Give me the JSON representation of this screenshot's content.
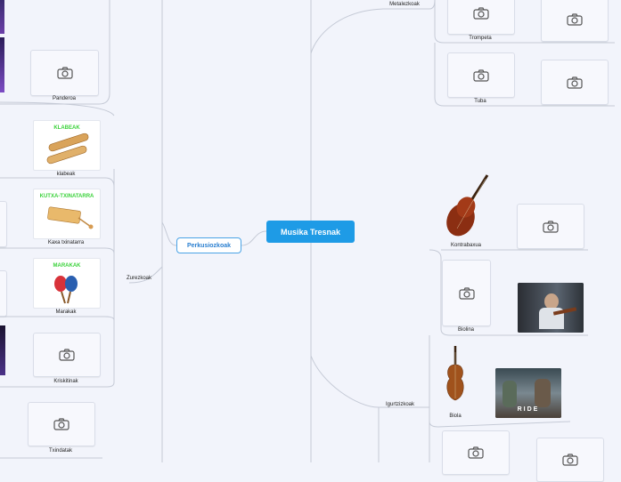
{
  "map": {
    "central": "Musika Tresnak",
    "branch": "Perkusiozkoak"
  },
  "labels": {
    "pandero": "Panderoa",
    "klabeak": "klabeak",
    "kaxa": "Kaxa txinatarra",
    "marakak": "Marakak",
    "krisk": "Kriskitinak",
    "txin": "Txindatak",
    "zurezkoak": "Zurezkoak",
    "metalezkoak": "Metalezkoak",
    "trompeta": "Trompeta",
    "tuba": "Tuba",
    "kontrabaxua": "Kontrabaxua",
    "biolina": "Biolina",
    "biola": "Biola",
    "igurtzizkoak": "Igurtzizkoak"
  },
  "images": {
    "klabeak_title": "KLABEAK",
    "kaxa_title": "KUTXA-TXINATARRA",
    "marakak_title": "MARAKAK",
    "video_caption": "RIDE"
  },
  "colors": {
    "central": "#1e9be6",
    "branch_border": "#4aa3e6",
    "connector": "#c5cad6",
    "image_title": "#3bd23b"
  }
}
